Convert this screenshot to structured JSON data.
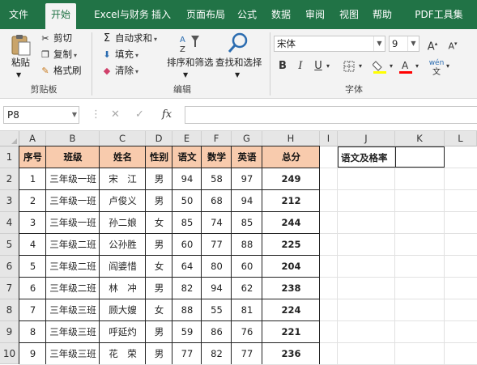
{
  "ribbon_tabs": [
    "文件",
    "开始",
    "Excel与财务",
    "插入",
    "页面布局",
    "公式",
    "数据",
    "审阅",
    "视图",
    "帮助",
    "PDF工具集"
  ],
  "active_tab": "开始",
  "clipboard": {
    "paste": "粘贴",
    "cut": "剪切",
    "copy": "复制",
    "format_painter": "格式刷",
    "group_label": "剪贴板"
  },
  "editing": {
    "autosum": "自动求和",
    "fill": "填充",
    "clear": "清除",
    "sort_filter": "排序和筛选",
    "find_select": "查找和选择",
    "group_label": "编辑"
  },
  "font": {
    "name": "宋体",
    "size": "9",
    "bold": "B",
    "italic": "I",
    "underline": "U",
    "wen": "wén",
    "group_label": "字体"
  },
  "formula_bar": {
    "name_box": "P8",
    "fx": "fx",
    "value": ""
  },
  "columns": [
    "A",
    "B",
    "C",
    "D",
    "E",
    "F",
    "G",
    "H",
    "I",
    "J",
    "K",
    "L"
  ],
  "row_numbers": [
    "1",
    "2",
    "3",
    "4",
    "5",
    "6",
    "7",
    "8",
    "9",
    "10"
  ],
  "table": {
    "headers": [
      "序号",
      "班级",
      "姓名",
      "性别",
      "语文",
      "数学",
      "英语",
      "总分"
    ],
    "rows": [
      [
        "1",
        "三年级一班",
        "宋　江",
        "男",
        "94",
        "58",
        "97",
        "249"
      ],
      [
        "2",
        "三年级一班",
        "卢俊义",
        "男",
        "50",
        "68",
        "94",
        "212"
      ],
      [
        "3",
        "三年级一班",
        "孙二娘",
        "女",
        "85",
        "74",
        "85",
        "244"
      ],
      [
        "4",
        "三年级二班",
        "公孙胜",
        "男",
        "60",
        "77",
        "88",
        "225"
      ],
      [
        "5",
        "三年级二班",
        "阎婆惜",
        "女",
        "64",
        "80",
        "60",
        "204"
      ],
      [
        "6",
        "三年级二班",
        "林　冲",
        "男",
        "82",
        "94",
        "62",
        "238"
      ],
      [
        "7",
        "三年级三班",
        "顾大嫂",
        "女",
        "88",
        "55",
        "81",
        "224"
      ],
      [
        "8",
        "三年级三班",
        "呼延灼",
        "男",
        "59",
        "86",
        "76",
        "221"
      ],
      [
        "9",
        "三年级三班",
        "花　荣",
        "男",
        "77",
        "82",
        "77",
        "236"
      ]
    ]
  },
  "side_cell": {
    "label": "语文及格率",
    "value": ""
  },
  "colors": {
    "excel_green": "#217346",
    "header_fill": "#f8cbad",
    "fill_yellow": "#ffff00",
    "font_red": "#ff0000"
  }
}
